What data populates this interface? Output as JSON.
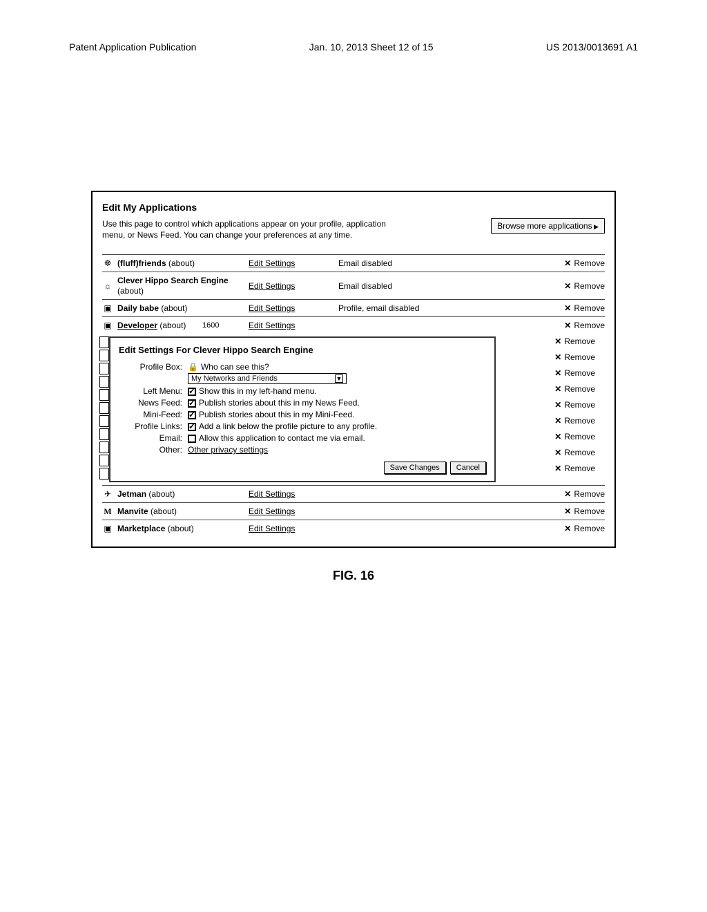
{
  "header": {
    "left": "Patent Application Publication",
    "center": "Jan. 10, 2013  Sheet 12 of 15",
    "right": "US 2013/0013691 A1"
  },
  "page": {
    "title": "Edit My Applications",
    "intro": "Use this page to control which applications appear on your profile, application menu, or News Feed. You can change your preferences at any time.",
    "browse_label": "Browse more applications",
    "edit_label": "Edit Settings",
    "remove_label": "Remove",
    "callout_ref": "1600"
  },
  "apps_top": [
    {
      "name": "(fluff)friends",
      "about": "(about)",
      "status": "Email disabled",
      "icon": "☸"
    },
    {
      "name": "Clever Hippo Search Engine",
      "about": "(about)",
      "status": "Email disabled",
      "icon": "☼",
      "twoline": true
    },
    {
      "name": "Daily babe",
      "about": "(about)",
      "status": "Profile, email disabled",
      "icon": "▣"
    },
    {
      "name": "Developer",
      "about": "(about)",
      "status": "",
      "icon": "▣"
    }
  ],
  "panel": {
    "title": "Edit Settings For Clever Hippo Search Engine",
    "profile_box_label": "Profile Box:",
    "who_can_see": "Who can see this?",
    "dropdown_value": "My Networks and Friends",
    "rows": [
      {
        "label": "Left Menu:",
        "text": "Show this in my left-hand menu.",
        "checked": true
      },
      {
        "label": "News Feed:",
        "text": "Publish stories about this in my News Feed.",
        "checked": true
      },
      {
        "label": "Mini-Feed:",
        "text": "Publish stories about this in my Mini-Feed.",
        "checked": true
      },
      {
        "label": "Profile Links:",
        "text": "Add a link below the profile picture to any profile.",
        "checked": true
      },
      {
        "label": "Email:",
        "text": "Allow this application to contact me via email.",
        "checked": false
      },
      {
        "label": "Other:",
        "text": "Other privacy settings",
        "link": true
      }
    ],
    "save": "Save Changes",
    "cancel": "Cancel"
  },
  "apps_bottom": [
    {
      "name": "Jetman",
      "about": "(about)",
      "icon": "✈"
    },
    {
      "name": "Manvite",
      "about": "(about)",
      "icon": "M",
      "boldicon": true
    },
    {
      "name": "Marketplace",
      "about": "(about)",
      "icon": "▣"
    }
  ],
  "figure_caption": "FIG. 16"
}
